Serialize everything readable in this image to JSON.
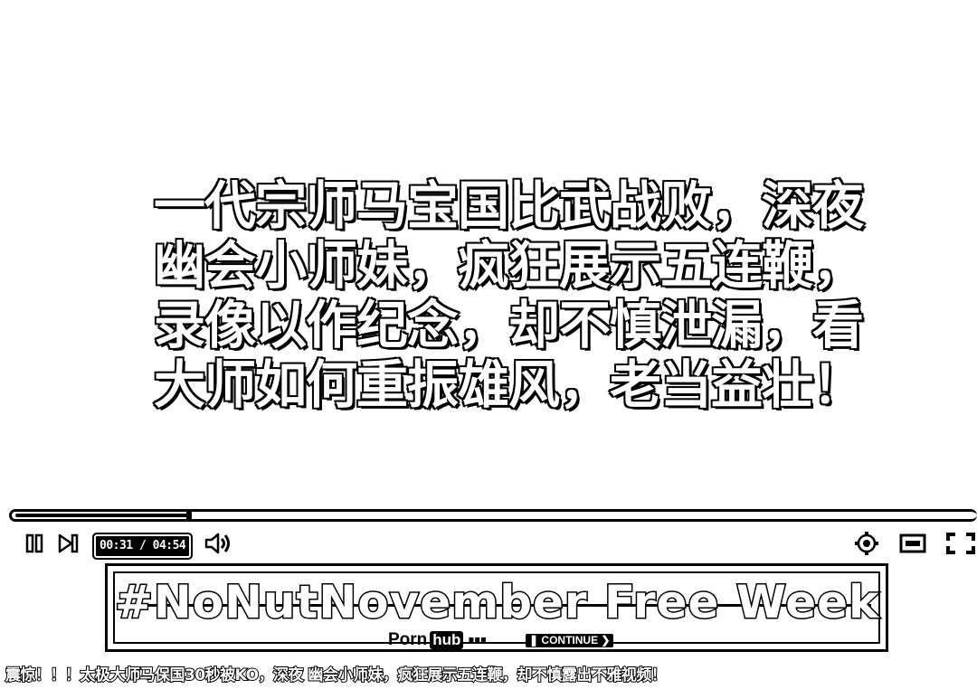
{
  "video": {
    "subtitle_lines": [
      "一代宗师马宝国比武战败，深夜",
      "幽会小师妹，疯狂展示五连鞭，",
      "录像以作纪念，却不慎泄漏，看",
      "大师如何重振雄风，老当益壮！"
    ]
  },
  "player": {
    "progress_fraction": 0.1806,
    "time_display": "00:31 / 04:54",
    "icons": {
      "pause": "pause-icon",
      "next": "next-icon",
      "volume": "volume-icon",
      "settings": "gear-icon",
      "theater": "theater-mode-icon",
      "fullscreen": "fullscreen-icon"
    }
  },
  "ad": {
    "headline": "#NoNutNovember Free Week",
    "brand_part1": "Porn",
    "brand_part2": "hub",
    "continue_label": "CONTINUE"
  },
  "page": {
    "title": "震惊！！！太极大师马保国30秒被KO，深夜 幽会小师妹，疯狂展示五连鞭，却不慎露出不雅视频！"
  }
}
